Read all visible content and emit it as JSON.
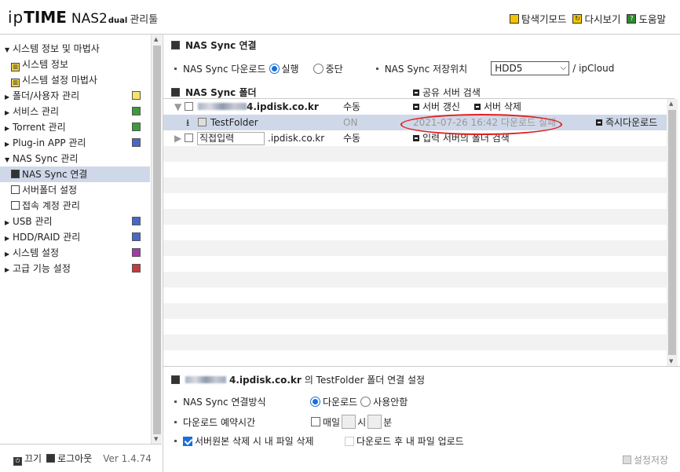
{
  "header": {
    "logo_ip": "ip",
    "logo_time": "TIME",
    "logo_nas": "NAS2",
    "logo_dual": "dual",
    "logo_admin": "관리툴",
    "links": [
      {
        "label": "탐색기모드",
        "icon": "explorer-icon"
      },
      {
        "label": "다시보기",
        "icon": "refresh-icon"
      },
      {
        "label": "도움말",
        "icon": "help-icon"
      }
    ]
  },
  "sidebar": {
    "items": [
      {
        "label": "시스템 정보 및 마법사",
        "expanded": true
      },
      {
        "label": "시스템 정보"
      },
      {
        "label": "시스템 설정 마법사"
      },
      {
        "label": "폴더/사용자 관리"
      },
      {
        "label": "서비스 관리"
      },
      {
        "label": "Torrent 관리"
      },
      {
        "label": "Plug-in APP 관리"
      },
      {
        "label": "NAS Sync 관리",
        "expanded": true
      },
      {
        "label": "NAS Sync 연결",
        "active": true
      },
      {
        "label": "서버폴더 설정"
      },
      {
        "label": "접속 계정 관리"
      },
      {
        "label": "USB 관리"
      },
      {
        "label": "HDD/RAID 관리"
      },
      {
        "label": "시스템 설정"
      },
      {
        "label": "고급 기능 설정"
      }
    ],
    "footer": {
      "power": "끄기",
      "logout": "로그아웃",
      "version": "Ver 1.4.74"
    }
  },
  "main": {
    "section_title": "NAS Sync 연결",
    "download_label": "NAS Sync 다운로드",
    "run_label": "실행",
    "stop_label": "중단",
    "storage_label": "NAS Sync 저장위치",
    "storage_value": "HDD5",
    "storage_suffix": "/ ipCloud",
    "folder_title": "NAS Sync 폴더",
    "search_shared": "공유 서버 검색",
    "rows": {
      "server1_domain": "4.ipdisk.co.kr",
      "server1_mode": "수동",
      "server_refresh": "서버 갱신",
      "server_delete": "서버 삭제",
      "folder_name": "TestFolder",
      "folder_state": "ON",
      "folder_status": "2021-07-26 16:42 다운로드 실패",
      "instant_download": "즉시다운로드",
      "direct_input": "직접입력",
      "direct_domain": ".ipdisk.co.kr",
      "direct_mode": "수동",
      "search_input_server": "입력 서버의 폴더 검색"
    }
  },
  "settings": {
    "title_domain": "4.ipdisk.co.kr",
    "title_suffix": "의 TestFolder 폴더 연결 설정",
    "method_label": "NAS Sync 연결방식",
    "method_download": "다운로드",
    "method_disabled": "사용안함",
    "schedule_label": "다운로드 예약시간",
    "daily": "매일",
    "hour": "시",
    "minute": "분",
    "delete_label": "서버원본 삭제 시 내 파일 삭제",
    "upload_label": "다운로드 후 내 파일 업로드",
    "save_label": "설정저장"
  }
}
